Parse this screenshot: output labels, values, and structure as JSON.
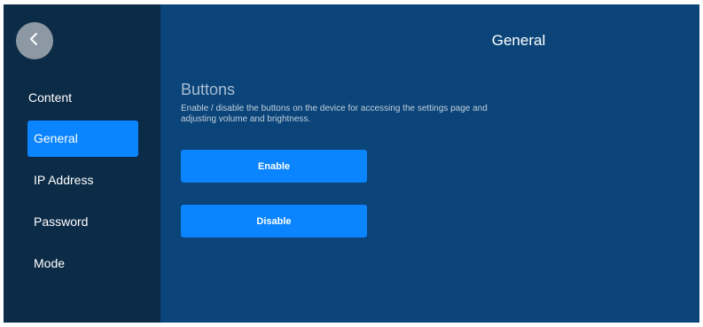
{
  "header": {
    "title": "General",
    "back_icon": "chevron-left-icon"
  },
  "sidebar": {
    "heading": "Content",
    "items": [
      {
        "label": "General",
        "active": true
      },
      {
        "label": "IP Address",
        "active": false
      },
      {
        "label": "Password",
        "active": false
      },
      {
        "label": "Mode",
        "active": false
      }
    ]
  },
  "main": {
    "section_title": "Buttons",
    "section_description": "Enable / disable the buttons on the device for accessing the settings page and adjusting volume and brightness.",
    "enable_label": "Enable",
    "disable_label": "Disable"
  },
  "colors": {
    "sidebar_bg": "#0c2b47",
    "main_bg": "#0b4479",
    "accent": "#0a84ff"
  }
}
